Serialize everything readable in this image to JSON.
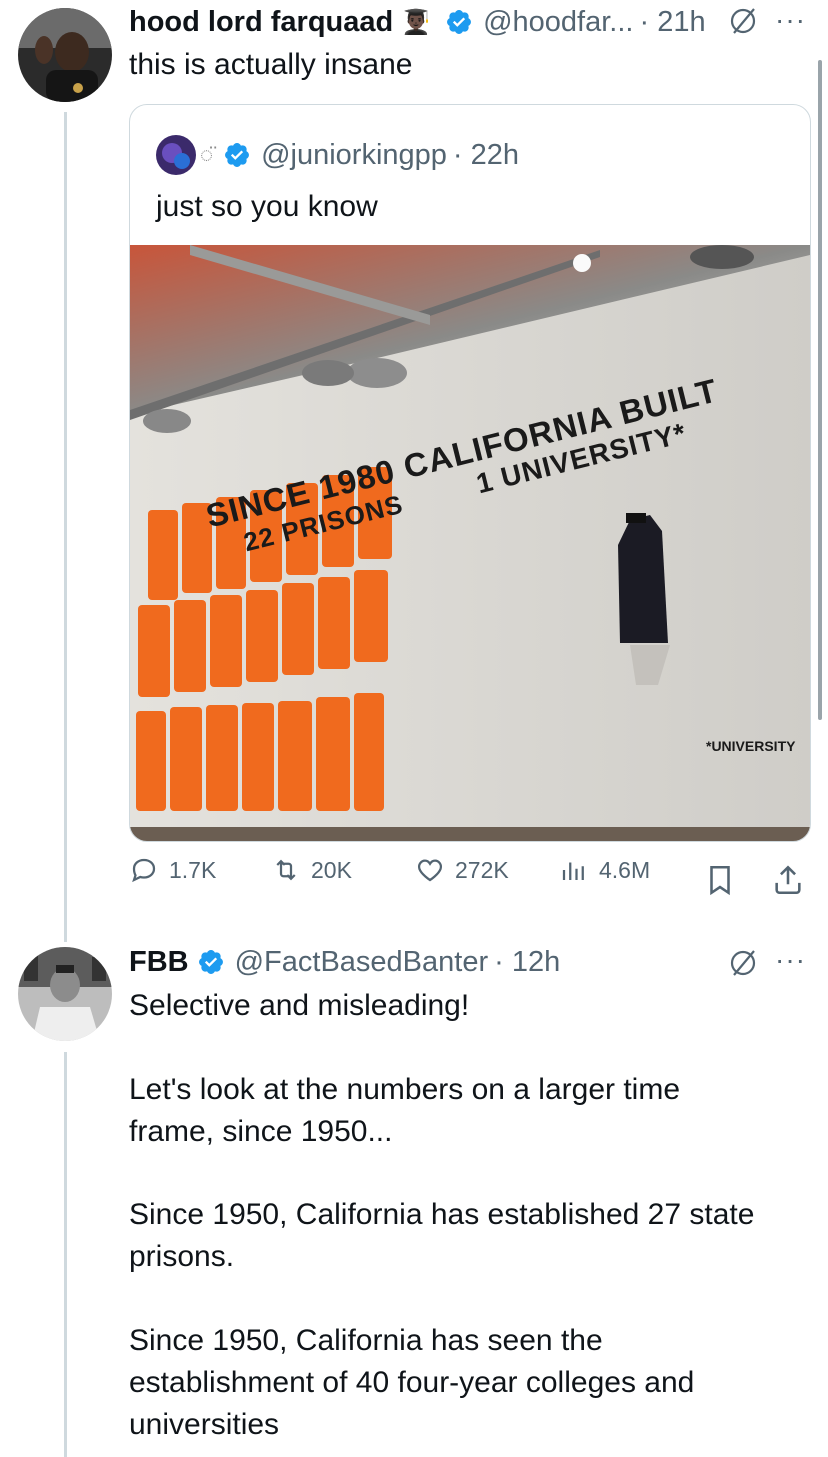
{
  "tweet1": {
    "name": "hood lord farquaad",
    "emoji": "👨🏿‍🎓",
    "handle": "@hoodfar...",
    "time": "· 21h",
    "text": "this is actually insane",
    "more": "···"
  },
  "quote": {
    "handle": "@juniorkingpp",
    "time": "· 22h",
    "text": "just so you know",
    "image": {
      "wall_line1": "SINCE 1980 CALIFORNIA BUILT",
      "wall_line2_left": "22 PRISONS",
      "wall_line2_right": "1 UNIVERSITY*",
      "footnote": "*UNIVERSITY"
    }
  },
  "actions": {
    "replies": "1.7K",
    "reposts": "20K",
    "likes": "272K",
    "views": "4.6M"
  },
  "tweet2": {
    "name": "FBB",
    "handle": "@FactBasedBanter",
    "time": "· 12h",
    "more": "···",
    "paragraphs": [
      "Selective and misleading!",
      "Let's look at the numbers on a larger time frame, since 1950...",
      "Since 1950, California has established 27 state prisons.",
      "Since 1950, California has seen the establishment of 40 four-year colleges and universities"
    ]
  },
  "colors": {
    "verified": "#1d9bf0",
    "secondary_text": "#536471",
    "thread_line": "#cfd9de",
    "jumpsuit": "#f06a1e"
  }
}
